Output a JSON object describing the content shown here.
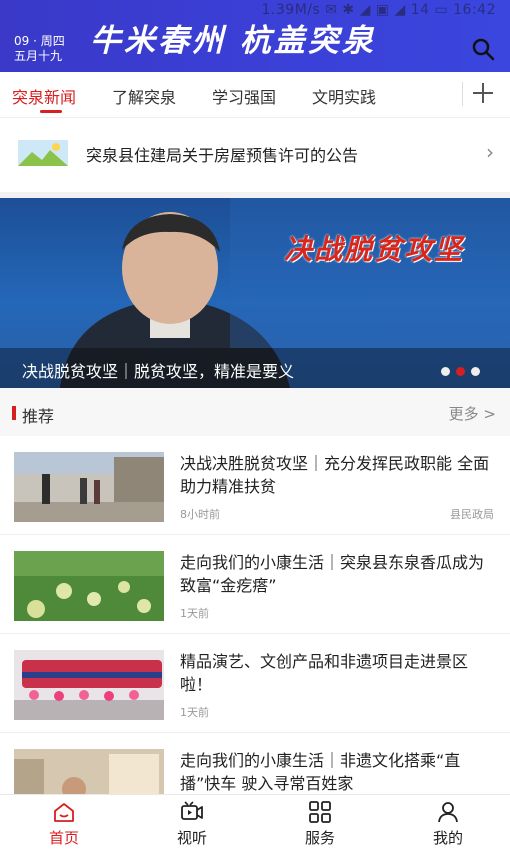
{
  "status_bar": {
    "text": "1.39M/s  ✉ ✱ ◢ ▣ ◢ 14 ▭ 16:42"
  },
  "header": {
    "date_line1": "09 · 周四",
    "date_line2": "五月十九",
    "brand": "牛米春州  杭盖突泉"
  },
  "tabs": [
    {
      "label": "突泉新闻"
    },
    {
      "label": "了解突泉"
    },
    {
      "label": "学习强国"
    },
    {
      "label": "文明实践"
    }
  ],
  "notice": {
    "text": "突泉县住建局关于房屋预售许可的公告"
  },
  "banner": {
    "title": "决战脱贫攻坚",
    "caption": "决战脱贫攻坚｜脱贫攻坚，精准是要义",
    "active_index": 1,
    "count": 3
  },
  "section": {
    "title": "推荐",
    "more": "更多 >"
  },
  "news": [
    {
      "title": "决战决胜脱贫攻坚｜充分发挥民政职能 全面助力精准扶贫",
      "time": "8小时前",
      "source": "县民政局"
    },
    {
      "title": "走向我们的小康生活｜突泉县东泉香瓜成为致富“金疙瘩”",
      "time": "1天前",
      "source": ""
    },
    {
      "title": "精品演艺、文创产品和非遗项目走进景区啦！",
      "time": "1天前",
      "source": ""
    },
    {
      "title": "走向我们的小康生活｜非遗文化搭乘“直播”快车 驶入寻常百姓家",
      "time": "",
      "source": ""
    }
  ],
  "bottom_nav": [
    {
      "label": "首页",
      "icon": "home-icon"
    },
    {
      "label": "视听",
      "icon": "video-icon"
    },
    {
      "label": "服务",
      "icon": "grid-icon"
    },
    {
      "label": "我的",
      "icon": "user-icon"
    }
  ],
  "colors": {
    "accent": "#d71f1f",
    "header": "#3a3fd2"
  }
}
